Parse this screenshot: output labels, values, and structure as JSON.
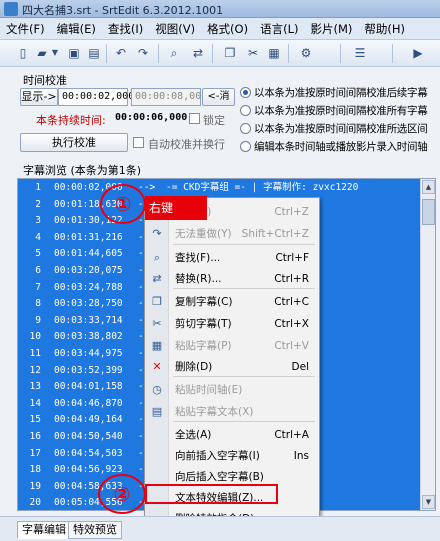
{
  "window": {
    "title": "四大名捕3.srt - SrtEdit 6.3.2012.1001"
  },
  "menu": [
    "文件(F)",
    "编辑(E)",
    "查找(I)",
    "视图(V)",
    "格式(O)",
    "语言(L)",
    "影片(M)",
    "帮助(H)"
  ],
  "toolbar_icons": [
    "new-file-icon",
    "open-folder-icon",
    "dropdown-arrow-icon",
    "save-icon",
    "save-as-icon",
    "undo-icon",
    "redo-icon",
    "find-icon",
    "replace-icon",
    "copy-icon",
    "cut-icon",
    "paste-icon",
    "delete-icon",
    "settings-icon",
    "list-view-icon",
    "play-icon"
  ],
  "time_correction": {
    "title": "时间校准",
    "display_button": "显示->",
    "display_time": "00:00:02,000",
    "target_time": "00:00:08,000",
    "cancel_button": "<-消",
    "duration_label": "本条持续时间:",
    "duration_value": "00:00:06,000",
    "lock_label": "锁定",
    "execute_button": "执行校准",
    "auto_label": "自动校准并换行",
    "options": [
      {
        "label": "以本条为准按原时间间隔校准后续字幕",
        "selected": true
      },
      {
        "label": "以本条为准按原时间间隔校准所有字幕",
        "selected": false
      },
      {
        "label": "以本条为准按原时间间隔校准所选区间",
        "selected": false
      },
      {
        "label": "编辑本条时间轴或播放影片录入时间轴",
        "selected": false
      }
    ]
  },
  "subtitle_list": {
    "title": "字幕浏览 (本条为第1条)",
    "rows": [
      {
        "num": "1",
        "start": "00:00:02,000",
        "text": "-= CKD字幕组 =- | 字幕制作: zvxc1220"
      },
      {
        "num": "2",
        "start": "00:01:18,630",
        "text": ""
      },
      {
        "num": "3",
        "start": "00:01:30,122",
        "text": ""
      },
      {
        "num": "4",
        "start": "00:01:31,216",
        "text": ""
      },
      {
        "num": "5",
        "start": "00:01:44,605",
        "text": ""
      },
      {
        "num": "6",
        "start": "00:03:20,075",
        "text": ""
      },
      {
        "num": "7",
        "start": "00:03:24,788",
        "text": ""
      },
      {
        "num": "8",
        "start": "00:03:28,750",
        "text": ""
      },
      {
        "num": "9",
        "start": "00:03:33,714",
        "text": ""
      },
      {
        "num": "10",
        "start": "00:03:38,802",
        "text": ""
      },
      {
        "num": "11",
        "start": "00:03:44,975",
        "text": ""
      },
      {
        "num": "12",
        "start": "00:03:52,399",
        "text": ""
      },
      {
        "num": "13",
        "start": "00:04:01,158",
        "text": ""
      },
      {
        "num": "14",
        "start": "00:04:46,870",
        "text": ""
      },
      {
        "num": "15",
        "start": "00:04:49,164",
        "text": ""
      },
      {
        "num": "16",
        "start": "00:04:50,540",
        "text": ""
      },
      {
        "num": "17",
        "start": "00:04:54,503",
        "text": ""
      },
      {
        "num": "18",
        "start": "00:04:56,923",
        "text": ""
      },
      {
        "num": "19",
        "start": "00:04:58,633",
        "text": ""
      },
      {
        "num": "20",
        "start": "00:05:04,556",
        "text": "的大牢"
      }
    ]
  },
  "annotations": {
    "step1": "①",
    "step1_tag": "右键",
    "step2": "②"
  },
  "context_menu": {
    "items": [
      {
        "label": "撤消(V)",
        "shortcut": "Ctrl+Z",
        "disabled": true,
        "icon": "undo-icon"
      },
      {
        "label": "无法重做(Y)",
        "shortcut": "Shift+Ctrl+Z",
        "disabled": true,
        "icon": "redo-icon"
      },
      {
        "label": "查找(F)...",
        "shortcut": "Ctrl+F",
        "disabled": false,
        "icon": "find-icon"
      },
      {
        "label": "替换(R)...",
        "shortcut": "Ctrl+R",
        "disabled": false,
        "icon": "replace-icon"
      },
      {
        "label": "复制字幕(C)",
        "shortcut": "Ctrl+C",
        "disabled": false,
        "icon": "copy-icon"
      },
      {
        "label": "剪切字幕(T)",
        "shortcut": "Ctrl+X",
        "disabled": false,
        "icon": "cut-icon"
      },
      {
        "label": "粘贴字幕(P)",
        "shortcut": "Ctrl+V",
        "disabled": true,
        "icon": "paste-icon"
      },
      {
        "label": "删除(D)",
        "shortcut": "Del",
        "disabled": false,
        "icon": "delete-icon"
      },
      {
        "label": "粘贴时间轴(E)",
        "shortcut": "",
        "disabled": true,
        "icon": "paste-time-icon"
      },
      {
        "label": "粘贴字幕文本(X)",
        "shortcut": "",
        "disabled": true,
        "icon": "paste-text-icon"
      },
      {
        "label": "全选(A)",
        "shortcut": "Ctrl+A",
        "disabled": false,
        "icon": ""
      },
      {
        "label": "向前插入空字幕(I)",
        "shortcut": "Ins",
        "disabled": false,
        "icon": ""
      },
      {
        "label": "向后插入空字幕(B)",
        "shortcut": "",
        "disabled": false,
        "icon": ""
      },
      {
        "label": "文本特效编辑(Z)...",
        "shortcut": "",
        "disabled": false,
        "icon": ""
      },
      {
        "label": "删除特效指令(D)",
        "shortcut": "",
        "disabled": false,
        "icon": ""
      }
    ]
  },
  "tabs": [
    "字幕编辑",
    "特效预览"
  ]
}
